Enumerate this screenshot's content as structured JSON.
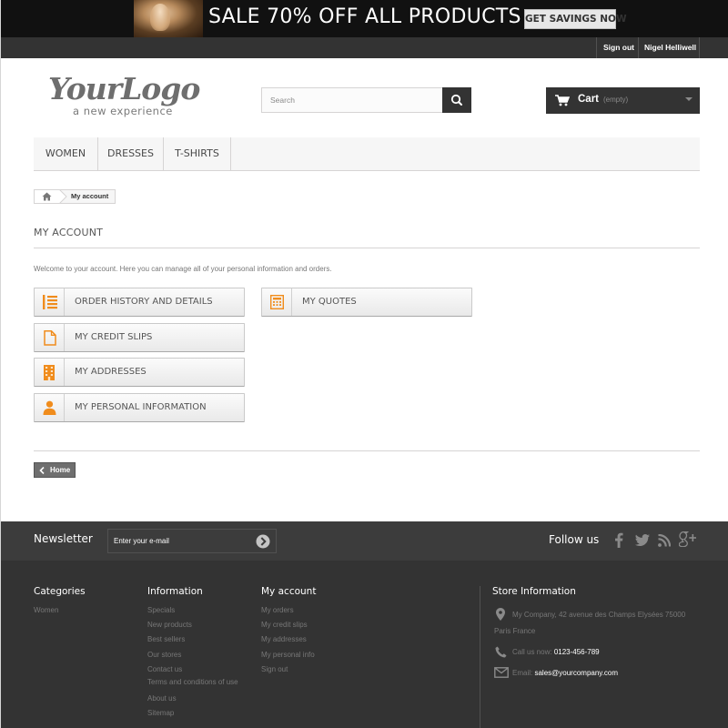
{
  "banner": {
    "headline": "SALE 70% OFF ALL PRODUCTS",
    "button_label": "GET SAVINGS NOW"
  },
  "topnav": {
    "sign_out": "Sign out",
    "user_name": "Nigel Helliwell"
  },
  "logo": {
    "main": "YourLogo",
    "tagline": "a new experience"
  },
  "search": {
    "placeholder": "Search"
  },
  "cart": {
    "label": "Cart",
    "status": "(empty)"
  },
  "menu": {
    "items": [
      "WOMEN",
      "DRESSES",
      "T-SHIRTS"
    ]
  },
  "breadcrumb": {
    "current": "My account"
  },
  "account": {
    "title": "MY ACCOUNT",
    "welcome": "Welcome to your account. Here you can manage all of your personal information and orders.",
    "buttons": {
      "order_history": "ORDER HISTORY AND DETAILS",
      "credit_slips": "MY CREDIT SLIPS",
      "addresses": "MY ADDRESSES",
      "personal_info": "MY PERSONAL INFORMATION",
      "quotes": "MY QUOTES"
    },
    "home_label": "Home"
  },
  "colors": {
    "accent_orange": "#f08c1c",
    "dark": "#333333"
  },
  "footer": {
    "newsletter_title": "Newsletter",
    "newsletter_placeholder": "Enter your e-mail",
    "follow_title": "Follow us",
    "social_icons": [
      "facebook-icon",
      "twitter-icon",
      "rss-icon",
      "google-plus-icon"
    ],
    "categories": {
      "title": "Categories",
      "links": [
        "Women"
      ]
    },
    "information": {
      "title": "Information",
      "links": [
        "Specials",
        "New products",
        "Best sellers",
        "Our stores",
        "Contact us",
        "Terms and conditions of use",
        "About us",
        "Sitemap"
      ]
    },
    "my_account": {
      "title": "My account",
      "links": [
        "My orders",
        "My credit slips",
        "My addresses",
        "My personal info",
        "Sign out"
      ]
    },
    "store": {
      "title": "Store Information",
      "address_line1": "My Company, 42 avenue des Champs Elysées 75000",
      "address_line2": "Paris France",
      "call_label": "Call us now:",
      "phone": "0123-456-789",
      "email_label": "Email:",
      "email": "sales@yourcompany.com"
    }
  }
}
